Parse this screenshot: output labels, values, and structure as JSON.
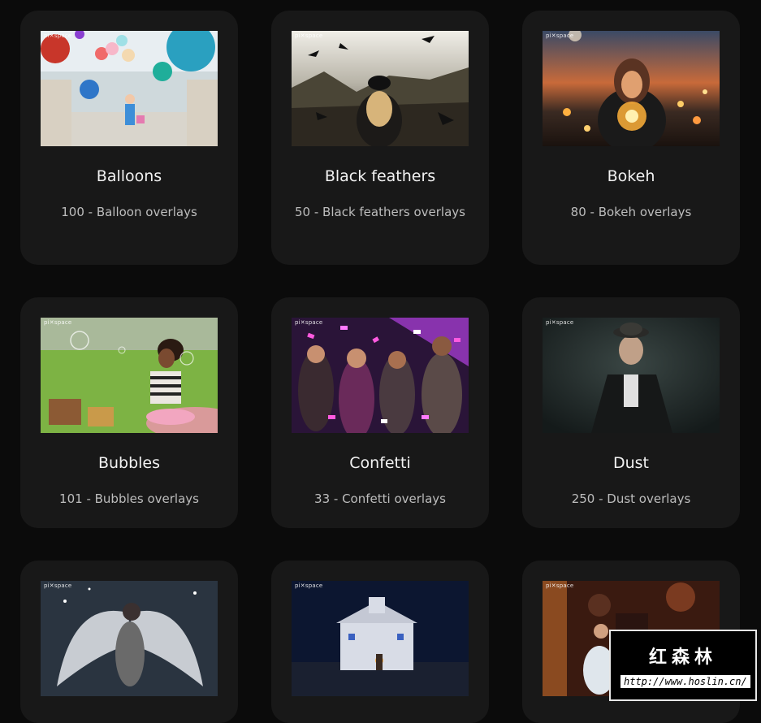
{
  "watermark": "pi✕space",
  "cards": [
    {
      "title": "Balloons",
      "subtitle": "100 - Balloon overlays"
    },
    {
      "title": "Black feathers",
      "subtitle": "50 - Black feathers overlays"
    },
    {
      "title": "Bokeh",
      "subtitle": "80 - Bokeh overlays"
    },
    {
      "title": "Bubbles",
      "subtitle": "101 - Bubbles overlays"
    },
    {
      "title": "Confetti",
      "subtitle": "33 - Confetti overlays"
    },
    {
      "title": "Dust",
      "subtitle": "250 - Dust overlays"
    }
  ],
  "badge": {
    "cn": "红森林",
    "url": "http://www.hoslin.cn/"
  }
}
